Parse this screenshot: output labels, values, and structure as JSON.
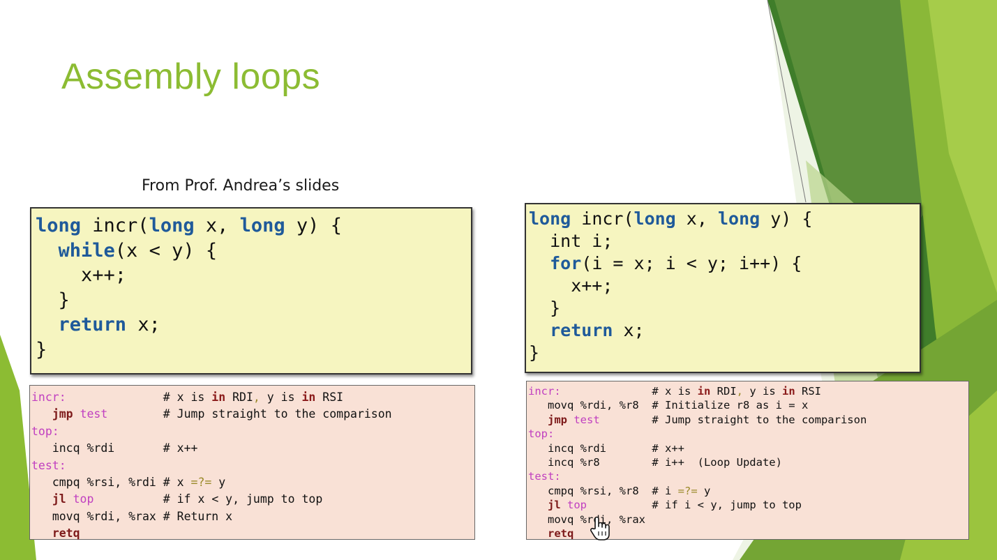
{
  "slide": {
    "title": "Assembly loops",
    "caption": "From Prof. Andrea’s slides"
  },
  "c_code_while": [
    {
      "kw": "long",
      "rest": " incr(",
      "kw2": "long",
      "rest2": " x, ",
      "kw3": "long",
      "rest3": " y) {"
    },
    {
      "indent": "  ",
      "kw": "while",
      "rest": "(x < y) {"
    },
    {
      "text": "    x++;"
    },
    {
      "text": "  }"
    },
    {
      "indent": "  ",
      "kw": "return",
      "rest": " x;"
    },
    {
      "text": "}"
    }
  ],
  "c_code_for": [
    {
      "kw": "long",
      "rest": " incr(",
      "kw2": "long",
      "rest2": " x, ",
      "kw3": "long",
      "rest3": " y) {"
    },
    {
      "text": "  int i;"
    },
    {
      "indent": "  ",
      "kw": "for",
      "rest": "(i = x; i < y; i++) {"
    },
    {
      "text": "    x++;"
    },
    {
      "text": "  }"
    },
    {
      "indent": "  ",
      "kw": "return",
      "rest": " x;"
    },
    {
      "text": "}"
    }
  ],
  "asm_left": {
    "l1_label": "incr:",
    "l1_comment_a": "# x is ",
    "in": "in",
    "l1_comment_b": " RDI",
    "comma": ",",
    "l1_comment_c": " y is ",
    "l1_comment_d": " RSI",
    "l2_op": "jmp",
    "l2_tgt": "test",
    "l2_comment": "# Jump straight to the comparison",
    "l3_label": "top:",
    "l4_instr": "incq %rdi",
    "l4_comment": "# x++",
    "l5_label": "test:",
    "l6_instr": "cmpq %rsi, %rdi",
    "l6_comment_a": "# x ",
    "l6_op": "=?=",
    "l6_comment_b": " y",
    "l7_op": "jl",
    "l7_tgt": "top",
    "l7_comment": "# if x < y, jump to top",
    "l8_instr": "movq %rdi, %rax",
    "l8_comment": "# Return x",
    "l9_op": "retq"
  },
  "asm_right": {
    "l1_label": "incr:",
    "l1_comment_a": "# x is ",
    "in": "in",
    "l1_comment_b": " RDI",
    "comma": ",",
    "l1_comment_c": " y is ",
    "l1_comment_d": " RSI",
    "l2_instr": "movq %rdi, %r8",
    "l2_comment": "# Initialize r8 as i = x",
    "l3_op": "jmp",
    "l3_tgt": "test",
    "l3_comment": "# Jump straight to the comparison",
    "l4_label": "top:",
    "l5_instr": "incq %rdi",
    "l5_comment": "# x++",
    "l6_instr": "incq %r8",
    "l6_comment": "# i++  (Loop Update)",
    "l7_label": "test:",
    "l8_instr": "cmpq %rsi, %r8",
    "l8_comment_a": "# i ",
    "l8_op": "=?=",
    "l8_comment_b": " y",
    "l9_op": "jl",
    "l9_tgt": "top",
    "l9_comment": "# if i < y, jump to top",
    "l10_instr": "movq %rdi, %rax",
    "l11_op": "retq"
  },
  "colors": {
    "title": "#8cbc33",
    "code_bg": "#f6f5c0",
    "asm_bg": "#f9e1d6",
    "keyword": "#1f5a9a",
    "label": "#c03fc0"
  },
  "cursor_icon": "hand-pointer-icon"
}
